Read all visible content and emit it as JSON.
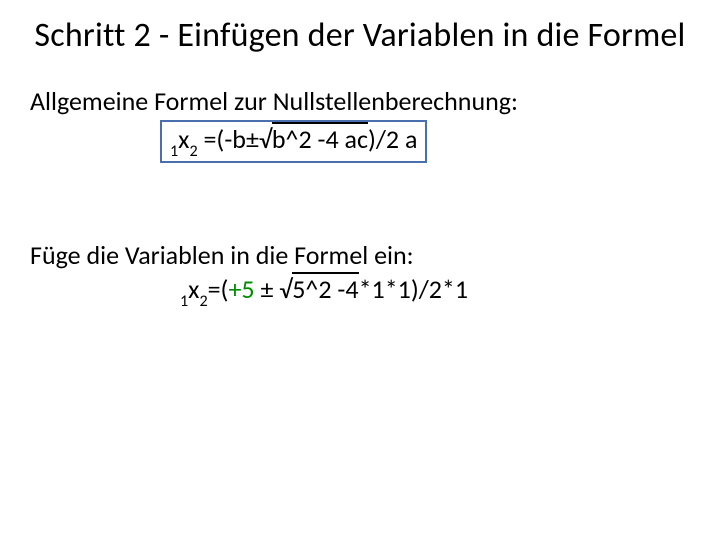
{
  "title": "Schritt 2 - Einfügen der Variablen in die Formel",
  "line1": "Allgemeine Formel zur Nullstellenberechnung:",
  "formula1": {
    "lead_sub1": "1",
    "lead_x": "x",
    "lead_sub2": "2",
    "eq": " =(-b±√",
    "radicand": "b^2 -4 ac",
    "tail": ")/2 a"
  },
  "line2": "Füge die Variablen in die Formel ein:",
  "formula2": {
    "lead_sub1": "1",
    "lead_x": "x",
    "lead_sub2": "2",
    "eq": "=(",
    "plus5": "+5",
    "mid": " ± √",
    "radicand": " 5^2 -4",
    "tail": "*1*1)/2*1"
  }
}
